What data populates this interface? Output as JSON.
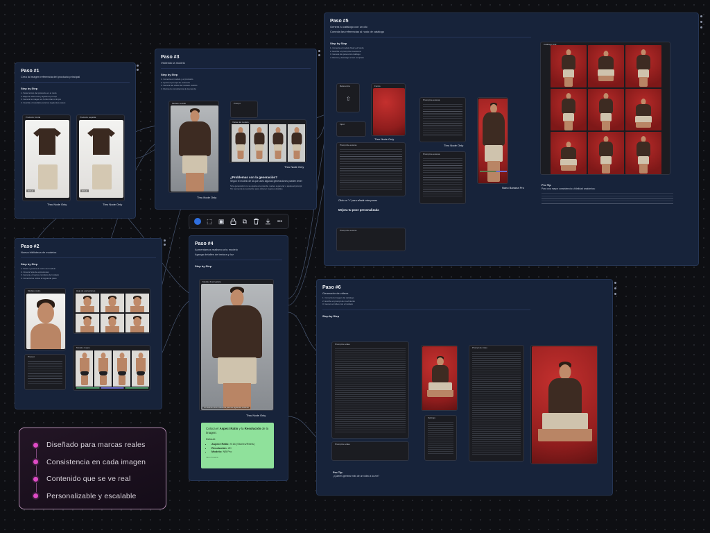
{
  "features": [
    "Diseñado para marcas reales",
    "Consistencia en cada imagen",
    "Contenido que se ve real",
    "Personalizable y escalable"
  ],
  "toolbar": {
    "items": [
      "color-picker",
      "frame",
      "group",
      "lock",
      "duplicate",
      "delete",
      "download",
      "more"
    ],
    "more_label": "•••"
  },
  "green_note": {
    "line1_a": "Coloca el ",
    "line1_b": "Aspect Ratio",
    "line1_c": " y la ",
    "line1_d": "Resolución",
    "line1_e": " de la imagen:",
    "default": "Default:",
    "items": [
      {
        "k": "Aspect Ratio:",
        "v": "9:16 (Stories/Reels)"
      },
      {
        "k": "Resolución:",
        "v": "2K"
      },
      {
        "k": "Modelo:",
        "v": "NB Pro"
      }
    ],
    "meta": "nano banana"
  },
  "tag_label": "Thru Node Only",
  "paso1": {
    "title": "Paso #1",
    "subtitle": "Crea la imagen referencia del producto principal",
    "step_by_step": "Step by Step",
    "steps": [
      "1. Sube la foto del producto en el nodo",
      "2. Elige la referencia y ajusta el prompt",
      "3. Genera la imagen en fondo blanco limpio",
      "4. Guarda el resultado para los siguientes pasos"
    ],
    "node_a": "Producto frontal",
    "node_b": "Producto espalda",
    "label_a": "ROLE",
    "label_b": "ROLE"
  },
  "paso2": {
    "title": "Paso #2",
    "subtitle": "Nueva biblioteca de modelos",
    "step_by_step": "Step by Step",
    "steps": [
      "1. Sube o genera el rostro del modelo",
      "2. Crea la hoja de expresiones",
      "3. Genera el cuerpo completo del modelo",
      "4. Conecta los nodos al siguiente paso"
    ],
    "node_face": "Modelo rostro",
    "node_sheet": "Hoja de expresiones",
    "node_body": "Modelo cuerpo"
  },
  "paso3": {
    "title": "Paso #3",
    "subtitle": "Vistiendo la modelo",
    "step_by_step": "Step by Step",
    "steps": [
      "1. Conecta el modelo y el producto",
      "2. Ajusta el prompt de vestuario",
      "3. Genera las vistas del modelo vestido",
      "4. Revisa la consistencia de la prenda"
    ],
    "node_model": "Modelo vestido",
    "node_views": "Vistas del modelo",
    "faq_title": "¿Problemas con la generación?",
    "faq_sub": "Según el modelo de IA que uses algunas generaciones pueden tener",
    "faq_body": [
      "Si la generación no se ajusta a tu prenda, vuelve a generar o ajusta el prompt",
      "Tip: aumenta la resolución para obtener mejores detalles"
    ]
  },
  "paso4": {
    "title": "Paso #4",
    "subtitle": "Aumentamos realismo a tu modelo",
    "sub2": "Agrega detalles de textura y luz",
    "step_by_step": "Step by Step",
    "node_label": "Modelo final realista",
    "caption": "Lo usamos como referencia para las siguientes escenas"
  },
  "paso5": {
    "title": "Paso #5",
    "subtitle": "Genera tu catálogo con un clic",
    "sub2": "Conecta las referencias al nodo de catálogo",
    "step_by_step": "Step by Step",
    "steps": [
      "1. Conecta el modelo final y el fondo",
      "2. Escribe el prompt de la escena",
      "3. Genera las poses del catálogo",
      "4. Revisa y descarga el set completo"
    ],
    "node_ref": "Referencia",
    "node_bg": "Fondo",
    "node_prompt": "Prompt de escena",
    "node_result": "Resultado",
    "node_grid": "Catálogo final",
    "click_hint": "Click en \"+\" para añadir más poses",
    "custom_title": "Mejora tu pose personalizada",
    "tip_title": "Pro Tip",
    "tip_sub": "Para una mayor consistencia y fidelidad anatómica:",
    "chip_nano": "Nano Banana Pro"
  },
  "paso6": {
    "title": "Paso #6",
    "subtitle": "Generador de videos",
    "steps": [
      "1. Conecta la imagen del catálogo",
      "2. Escribe el prompt de movimiento",
      "3. Genera el video con el modelo"
    ],
    "step_by_step": "Step by Step",
    "node_prompt": "Prompt de video",
    "node_img": "Imagen",
    "node_video": "Video",
    "tip_title": "Pro Tip",
    "tip_sub": "¿Quieres generar más de un video a la vez?"
  },
  "colors": {
    "group_bg": "#17233a",
    "accent_dot": "#e04bc6",
    "note_green": "#8fe19b",
    "toolbar_dot": "#2f6fe0"
  }
}
